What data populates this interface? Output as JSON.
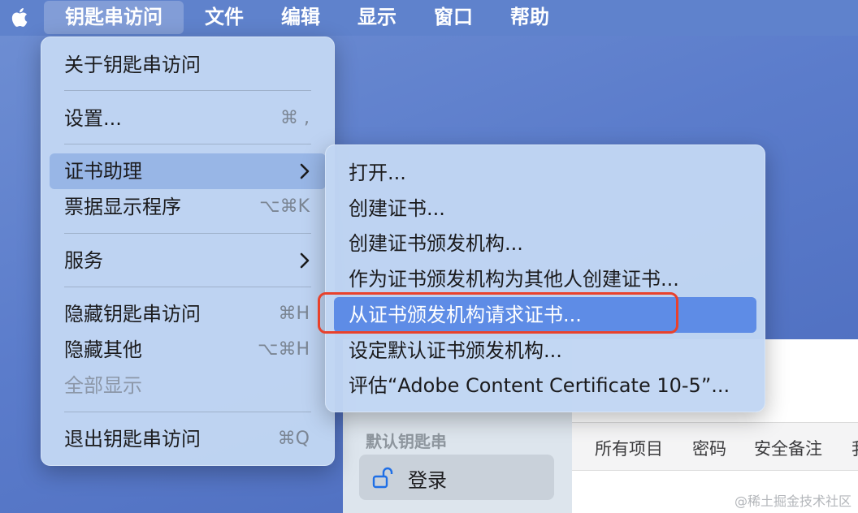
{
  "menubar": {
    "app_name": "钥匙串访问",
    "items": [
      "文件",
      "编辑",
      "显示",
      "窗口",
      "帮助"
    ]
  },
  "app_menu": {
    "about": "关于钥匙串访问",
    "settings": {
      "label": "设置...",
      "shortcut": "⌘ ,"
    },
    "cert_assistant": "证书助理",
    "ticket_viewer": {
      "label": "票据显示程序",
      "shortcut": "⌥⌘K"
    },
    "services": "服务",
    "hide": {
      "label": "隐藏钥匙串访问",
      "shortcut": "⌘H"
    },
    "hide_others": {
      "label": "隐藏其他",
      "shortcut": "⌥⌘H"
    },
    "show_all": "全部显示",
    "quit": {
      "label": "退出钥匙串访问",
      "shortcut": "⌘Q"
    }
  },
  "cert_submenu": {
    "items": [
      "打开...",
      "创建证书...",
      "创建证书颁发机构...",
      "作为证书颁发机构为其他人创建证书...",
      "从证书颁发机构请求证书...",
      "设定默认证书颁发机构...",
      "评估“Adobe Content Certificate 10-5”..."
    ],
    "selected_index": 4
  },
  "background_window": {
    "sidebar_heading": "默认钥匙串",
    "login_label": "登录",
    "tabs": [
      "所有项目",
      "密码",
      "安全备注",
      "我"
    ]
  },
  "watermark": "@稀土掘金技术社区",
  "colors": {
    "desktop": "#5b7ccb",
    "menu_bg": "#c1d6f3",
    "selection": "#5e8ce6",
    "annotation": "#e8412c"
  }
}
